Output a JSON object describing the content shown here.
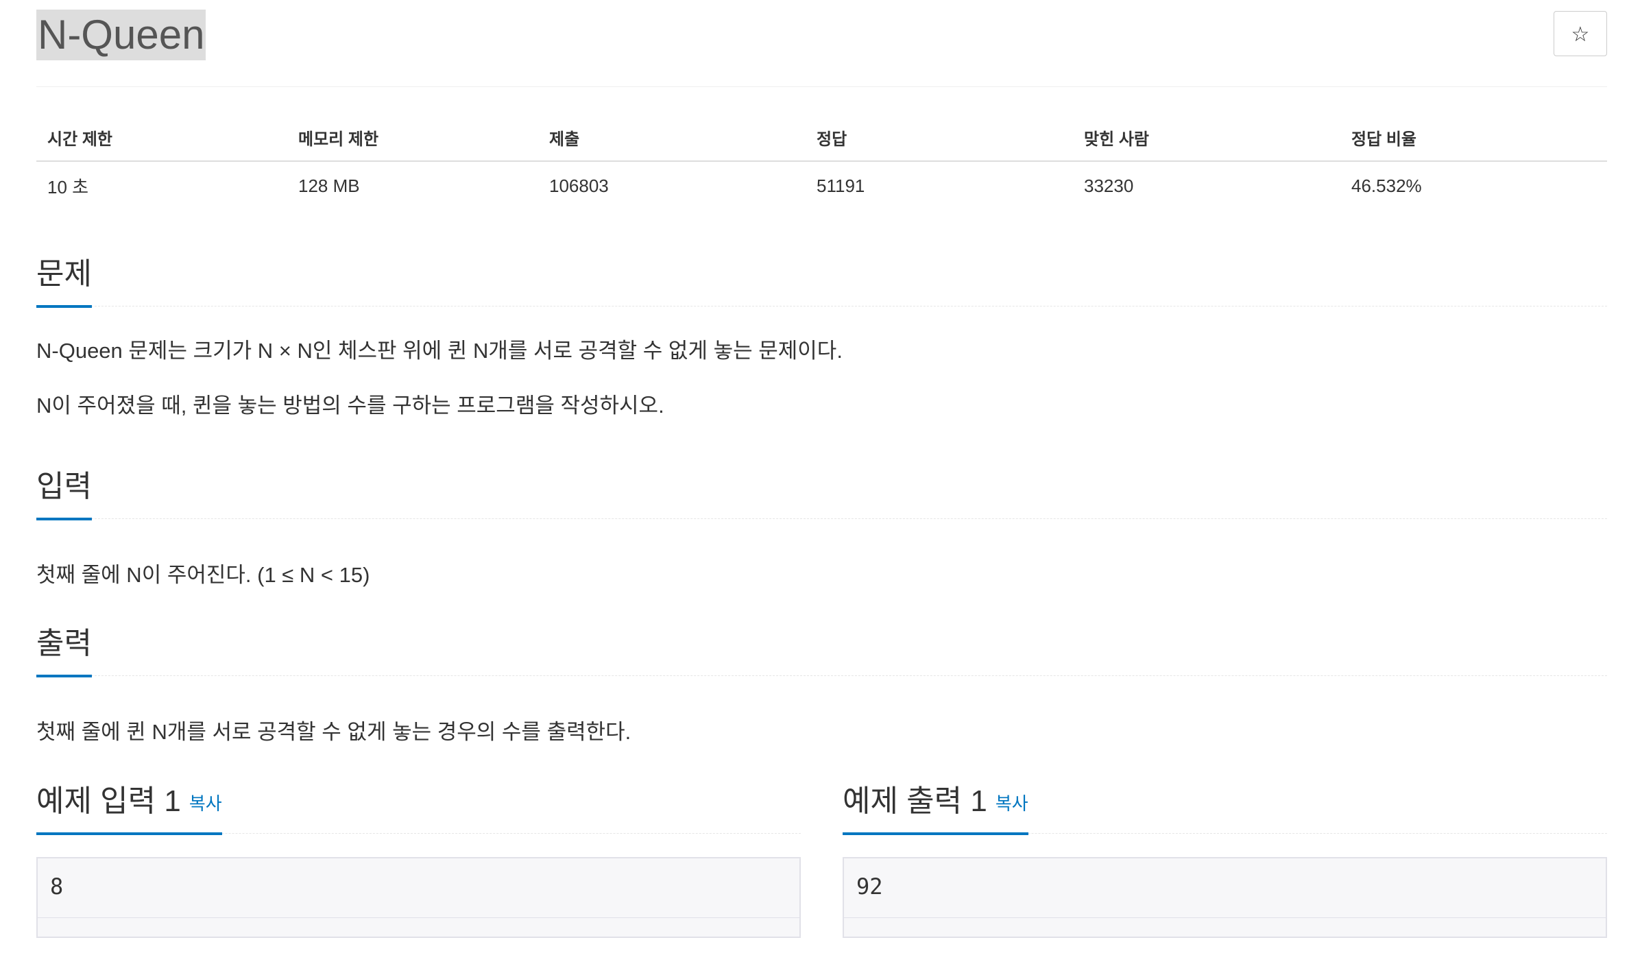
{
  "problem": {
    "title": "N-Queen",
    "star_icon": "☆"
  },
  "info_table": {
    "headers": [
      "시간 제한",
      "메모리 제한",
      "제출",
      "정답",
      "맞힌 사람",
      "정답 비율"
    ],
    "values": [
      "10 초",
      "128 MB",
      "106803",
      "51191",
      "33230",
      "46.532%"
    ]
  },
  "sections": {
    "description": {
      "title": "문제",
      "paragraphs": [
        "N-Queen 문제는 크기가 N × N인 체스판 위에 퀸 N개를 서로 공격할 수 없게 놓는 문제이다.",
        "N이 주어졌을 때, 퀸을 놓는 방법의 수를 구하는 프로그램을 작성하시오."
      ]
    },
    "input": {
      "title": "입력",
      "text": "첫째 줄에 N이 주어진다. (1 ≤ N < 15)"
    },
    "output": {
      "title": "출력",
      "text": "첫째 줄에 퀸 N개를 서로 공격할 수 없게 놓는 경우의 수를 출력한다."
    }
  },
  "samples": {
    "input": {
      "title": "예제 입력 1",
      "copy_label": "복사",
      "content": "8"
    },
    "output": {
      "title": "예제 출력 1",
      "copy_label": "복사",
      "content": "92"
    }
  },
  "colors": {
    "accent": "#0076c0",
    "title_highlight": "#dddddd",
    "sample_bg": "#f7f7f9"
  }
}
